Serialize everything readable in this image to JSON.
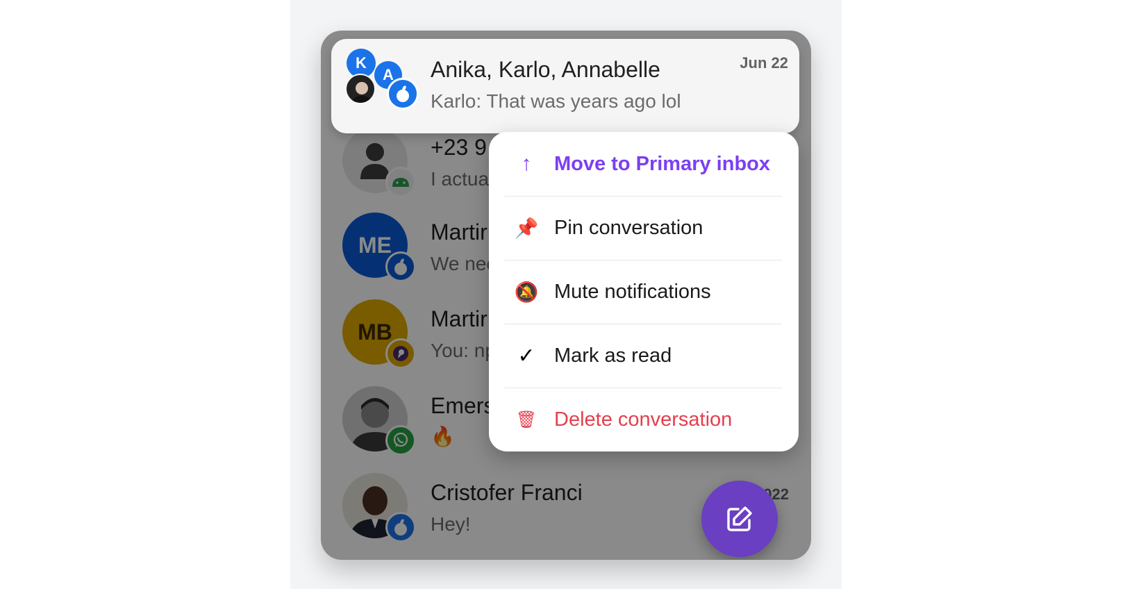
{
  "conversations": [
    {
      "name": "Anika, Karlo, Annabelle",
      "preview": "Karlo: That was years ago lol",
      "date": "Jun 22",
      "platform": "apple-icon",
      "avatar_letters": [
        "K",
        "A"
      ],
      "avatar_color": "#1a73e8"
    },
    {
      "name": "+23 9",
      "preview": "I actua",
      "platform": "android-icon"
    },
    {
      "name": "Martir",
      "preview": "We nee",
      "avatar_initials": "ME",
      "avatar_color": "#0a5bd6",
      "platform": "apple-icon"
    },
    {
      "name": "Martir",
      "preview": "You: np",
      "avatar_initials": "MB",
      "avatar_color": "#e0a800",
      "platform": "signal-icon"
    },
    {
      "name": "Emers",
      "preview": "🔥",
      "platform": "whatsapp-icon"
    },
    {
      "name": "Cristofer Franci",
      "preview": "Hey!",
      "date": "A    022",
      "platform": "apple-icon"
    }
  ],
  "context_menu": {
    "items": [
      {
        "label": "Move to Primary inbox",
        "icon": "↑",
        "icon_name": "arrow-up-icon",
        "color": "#7b3ff2"
      },
      {
        "label": "Pin conversation",
        "icon": "📌",
        "icon_name": "pin-icon",
        "color": "#1a1a1a"
      },
      {
        "label": "Mute notifications",
        "icon": "🔕",
        "icon_name": "bell-off-icon",
        "color": "#1a1a1a"
      },
      {
        "label": "Mark as read",
        "icon": "✓",
        "icon_name": "checkmark-icon",
        "color": "#1a1a1a"
      },
      {
        "label": "Delete conversation",
        "icon": "🗑",
        "icon_name": "trash-icon",
        "color": "#e53e4d"
      }
    ]
  },
  "compose_button": {
    "icon": "compose-icon"
  },
  "colors": {
    "accent": "#7b3ff2",
    "fab": "#6a3fc1",
    "danger": "#e53e4d",
    "imessage_blue": "#1a73e8",
    "whatsapp_green": "#25a244"
  }
}
